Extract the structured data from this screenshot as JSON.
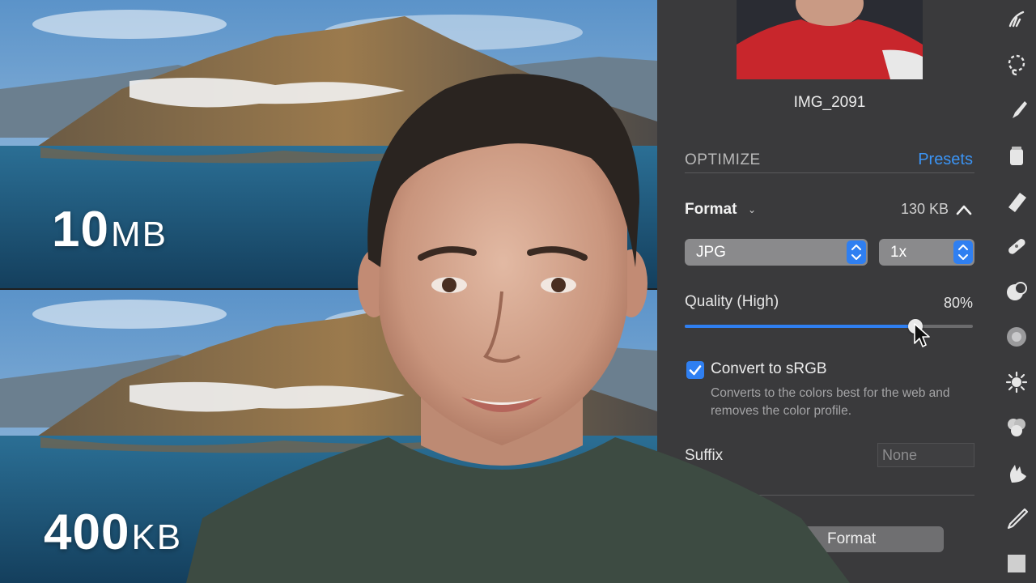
{
  "comparison": {
    "top": {
      "number": "10",
      "unit": "MB"
    },
    "bottom": {
      "number": "400",
      "unit": "KB"
    }
  },
  "export_panel": {
    "file_name": "IMG_2091",
    "section_title": "OPTIMIZE",
    "presets_label": "Presets",
    "format": {
      "label": "Format",
      "size": "130 KB",
      "type_value": "JPG",
      "scale_value": "1x"
    },
    "quality": {
      "label": "Quality (High)",
      "value_text": "80%",
      "level": 0.8
    },
    "convert_srgb": {
      "checked": true,
      "label": "Convert to sRGB",
      "description": "Converts to the colors best for the web and removes the color profile."
    },
    "suffix": {
      "label": "Suffix",
      "placeholder": "None"
    },
    "add_format_label": "Format"
  },
  "toolbar": {
    "tools": [
      "brush-icon",
      "lasso-icon",
      "pen-brush-icon",
      "paint-bucket-icon",
      "eraser-icon",
      "bandage-icon",
      "clone-icon",
      "dots-pattern-icon",
      "sun-icon",
      "color-circles-icon",
      "smudge-icon",
      "pen-nib-icon",
      "square-icon"
    ]
  },
  "colors": {
    "accent": "#2f7ff1",
    "link": "#3b94f5",
    "panel_bg": "#3a3a3c"
  }
}
